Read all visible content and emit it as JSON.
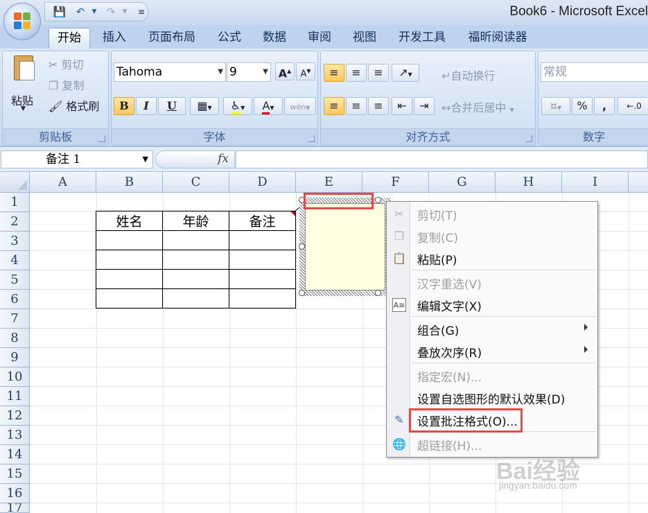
{
  "window": {
    "title": "Book6 - Microsoft Excel"
  },
  "tabs": [
    "开始",
    "插入",
    "页面布局",
    "公式",
    "数据",
    "审阅",
    "视图",
    "开发工具",
    "福昕阅读器"
  ],
  "ribbon": {
    "clipboard": {
      "paste": "粘贴",
      "cut": "剪切",
      "copy": "复制",
      "format_painter": "格式刷",
      "label": "剪贴板"
    },
    "font": {
      "family": "Tahoma",
      "size": "9",
      "bold": "B",
      "italic": "I",
      "underline": "U",
      "label": "字体",
      "font_color_glyph": "A",
      "phonetic_glyph": "wén"
    },
    "alignment": {
      "wrap_text": "自动换行",
      "merge_center": "合并后居中",
      "label": "对齐方式"
    },
    "number": {
      "format": "常规",
      "percent": "%",
      "comma": ",",
      "label": "数字"
    }
  },
  "formula_bar": {
    "name_box": "备注 1",
    "fx": "fx"
  },
  "columns": [
    "A",
    "B",
    "C",
    "D",
    "E",
    "F",
    "G",
    "H",
    "I"
  ],
  "rows": [
    "1",
    "2",
    "3",
    "4",
    "5",
    "6",
    "7",
    "8",
    "9",
    "10",
    "11",
    "12",
    "13",
    "14",
    "15",
    "16",
    "17"
  ],
  "table": {
    "headers": [
      "姓名",
      "年龄",
      "备注"
    ]
  },
  "context_menu": {
    "items": [
      {
        "label": "剪切(T)",
        "enabled": false,
        "icon": "scissors-icon"
      },
      {
        "label": "复制(C)",
        "enabled": false,
        "icon": "copy-icon"
      },
      {
        "label": "粘贴(P)",
        "enabled": true,
        "icon": "paste-icon"
      },
      {
        "label": "汉字重选(V)",
        "enabled": false,
        "icon": ""
      },
      {
        "label": "编辑文字(X)",
        "enabled": true,
        "icon": "edit-text-icon"
      },
      {
        "label": "组合(G)",
        "enabled": true,
        "icon": "",
        "submenu": true
      },
      {
        "label": "叠放次序(R)",
        "enabled": true,
        "icon": "",
        "submenu": true
      },
      {
        "label": "指定宏(N)...",
        "enabled": false,
        "icon": ""
      },
      {
        "label": "设置自选图形的默认效果(D)",
        "enabled": true,
        "icon": ""
      },
      {
        "label": "设置批注格式(O)...",
        "enabled": true,
        "icon": "format-comment-icon"
      },
      {
        "label": "超链接(H)...",
        "enabled": false,
        "icon": "hyperlink-icon"
      }
    ]
  },
  "watermark": {
    "brand": "Bai经验",
    "url": "jingyan.baidu.com"
  },
  "colors": {
    "highlight": "#e04a4a",
    "comment_fill": "#ffffe1",
    "ribbon": "#c8daf0"
  }
}
